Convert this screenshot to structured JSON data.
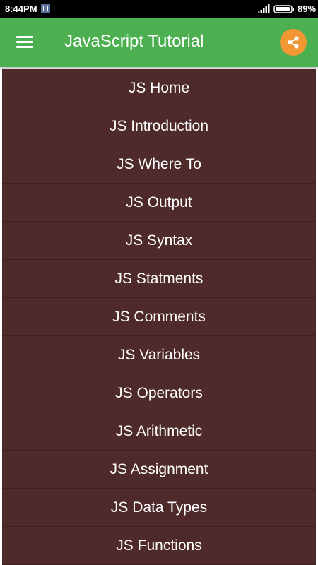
{
  "status_bar": {
    "time": "8:44PM",
    "battery": "89%",
    "notification_icon": "app-notification-icon",
    "signal_icon": "signal-icon",
    "battery_icon": "battery-icon"
  },
  "app_bar": {
    "title": "JavaScript Tutorial",
    "menu_icon": "hamburger-menu-icon",
    "share_icon": "share-icon",
    "color": "#4caf50",
    "share_color": "#f19734"
  },
  "menu": {
    "background": "#4e2a2a",
    "items": [
      {
        "label": "JS Home"
      },
      {
        "label": "JS Introduction"
      },
      {
        "label": "JS Where To"
      },
      {
        "label": "JS Output"
      },
      {
        "label": "JS Syntax"
      },
      {
        "label": "JS Statments"
      },
      {
        "label": "JS Comments"
      },
      {
        "label": "JS Variables"
      },
      {
        "label": "JS Operators"
      },
      {
        "label": "JS Arithmetic"
      },
      {
        "label": "JS Assignment"
      },
      {
        "label": "JS Data Types"
      },
      {
        "label": "JS Functions"
      }
    ]
  }
}
